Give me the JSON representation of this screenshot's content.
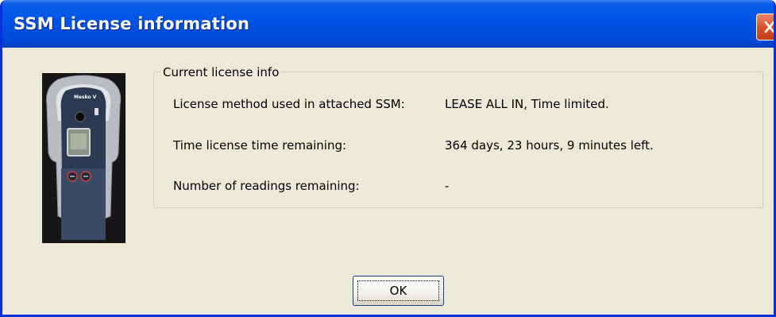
{
  "window": {
    "title": "SSM License information"
  },
  "device_image": {
    "brand_text": "Mesko V"
  },
  "group": {
    "legend": "Current license info",
    "rows": [
      {
        "label": "License method used in attached SSM:",
        "value": "LEASE ALL IN, Time limited."
      },
      {
        "label": "Time license time remaining:",
        "value": "364 days, 23 hours, 9 minutes left."
      },
      {
        "label": "Number of readings remaining:",
        "value": "-"
      }
    ]
  },
  "buttons": {
    "ok_label": "OK",
    "close_icon": "close-x-icon"
  },
  "colors": {
    "titlebar": "#0055e5",
    "window_bg": "#ece9d8",
    "close_button": "#d9542d"
  }
}
